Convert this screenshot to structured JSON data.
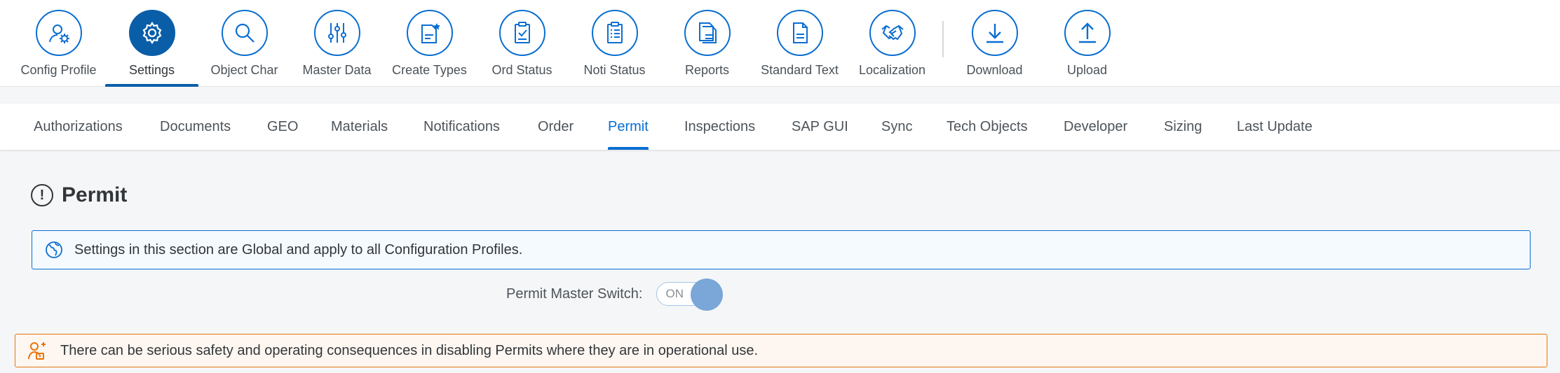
{
  "toolbar": {
    "items": [
      {
        "label": "Config Profile",
        "icon": "user-settings-icon"
      },
      {
        "label": "Settings",
        "icon": "gear-icon",
        "active": true
      },
      {
        "label": "Object Char",
        "icon": "search-icon"
      },
      {
        "label": "Master Data",
        "icon": "sliders-icon"
      },
      {
        "label": "Create Types",
        "icon": "document-star-icon"
      },
      {
        "label": "Ord Status",
        "icon": "clipboard-check-icon"
      },
      {
        "label": "Noti Status",
        "icon": "clipboard-list-icon"
      },
      {
        "label": "Reports",
        "icon": "documents-icon"
      },
      {
        "label": "Standard Text",
        "icon": "document-text-icon"
      },
      {
        "label": "Localization",
        "icon": "handshake-icon"
      },
      {
        "label": "Download",
        "icon": "download-icon"
      },
      {
        "label": "Upload",
        "icon": "upload-icon"
      }
    ]
  },
  "tabs": [
    {
      "label": "Authorizations"
    },
    {
      "label": "Documents"
    },
    {
      "label": "GEO"
    },
    {
      "label": "Materials"
    },
    {
      "label": "Notifications"
    },
    {
      "label": "Order"
    },
    {
      "label": "Permit",
      "active": true
    },
    {
      "label": "Inspections"
    },
    {
      "label": "SAP GUI"
    },
    {
      "label": "Sync"
    },
    {
      "label": "Tech Objects"
    },
    {
      "label": "Developer"
    },
    {
      "label": "Sizing"
    },
    {
      "label": "Last Update"
    }
  ],
  "section": {
    "title": "Permit",
    "title_icon": "alert-icon",
    "info_text": "Settings in this section are Global and apply to all Configuration Profiles.",
    "info_icon": "globe-icon",
    "switch_label": "Permit Master Switch:",
    "switch_state": "ON",
    "warning_text": "There can be serious safety and operating consequences in disabling Permits where they are in operational use.",
    "warning_icon": "person-alert-icon"
  },
  "colors": {
    "accent": "#0a6ed1",
    "accent_dark": "#0a5ea8",
    "warning": "#e9730c",
    "info_bg": "#f5faff",
    "warning_bg": "#fef7f1"
  }
}
